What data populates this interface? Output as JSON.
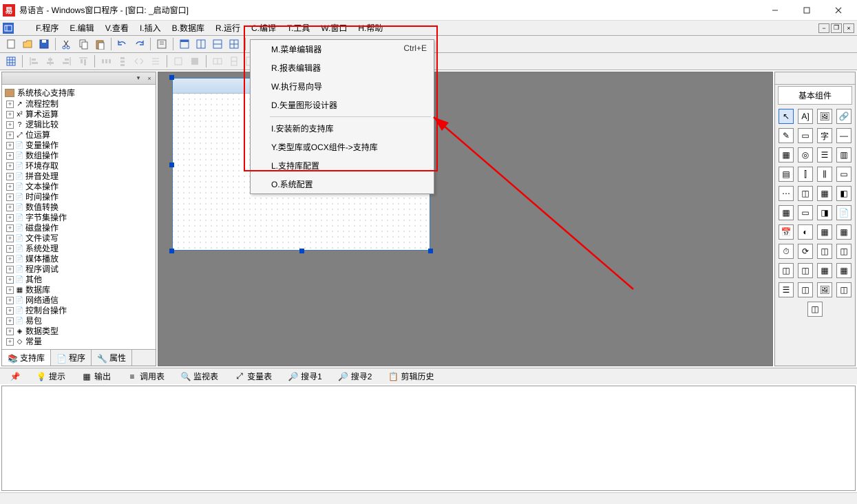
{
  "title": "易语言 - Windows窗口程序 - [窗口: _启动窗口]",
  "menus": {
    "program": "F.程序",
    "edit": "E.编辑",
    "view": "V.查看",
    "insert": "I.插入",
    "database": "B.数据库",
    "run": "R.运行",
    "compile": "C.编译",
    "tools": "T.工具",
    "window": "W.窗口",
    "help": "H.帮助"
  },
  "dropdown": {
    "menu_editor": "M.菜单编辑器",
    "menu_editor_shortcut": "Ctrl+E",
    "report_editor": "R.报表编辑器",
    "exec_wizard": "W.执行易向导",
    "vector_designer": "D.矢量图形设计器",
    "install_lib": "I.安装新的支持库",
    "ocx_lib": "Y.类型库或OCX组件->支持库",
    "lib_config": "L.支持库配置",
    "sys_config": "O.系统配置"
  },
  "tree": {
    "root": "系统核心支持库",
    "items": [
      {
        "icon": "↗",
        "label": "流程控制"
      },
      {
        "icon": "x²",
        "label": "算术运算"
      },
      {
        "icon": "?",
        "label": "逻辑比较"
      },
      {
        "icon": "⤢",
        "label": "位运算"
      },
      {
        "icon": "📄",
        "label": "变量操作"
      },
      {
        "icon": "📄",
        "label": "数组操作"
      },
      {
        "icon": "📄",
        "label": "环境存取"
      },
      {
        "icon": "📄",
        "label": "拼音处理"
      },
      {
        "icon": "📄",
        "label": "文本操作"
      },
      {
        "icon": "📄",
        "label": "时间操作"
      },
      {
        "icon": "📄",
        "label": "数值转换"
      },
      {
        "icon": "📄",
        "label": "字节集操作"
      },
      {
        "icon": "📄",
        "label": "磁盘操作"
      },
      {
        "icon": "📄",
        "label": "文件读写"
      },
      {
        "icon": "📄",
        "label": "系统处理"
      },
      {
        "icon": "📄",
        "label": "媒体播放"
      },
      {
        "icon": "📄",
        "label": "程序调试"
      },
      {
        "icon": "📄",
        "label": "其他"
      },
      {
        "icon": "▦",
        "label": "数据库"
      },
      {
        "icon": "📄",
        "label": "网络通信"
      },
      {
        "icon": "📄",
        "label": "控制台操作"
      },
      {
        "icon": "📄",
        "label": "易包"
      },
      {
        "icon": "◈",
        "label": "数据类型"
      },
      {
        "icon": "◇",
        "label": "常量"
      }
    ]
  },
  "left_tabs": {
    "lib": "支持库",
    "prog": "程序",
    "attr": "属性"
  },
  "right_panel": {
    "title": "基本组件"
  },
  "bottom_tabs": {
    "hint": "提示",
    "output": "输出",
    "calltable": "调用表",
    "watch": "监视表",
    "vars": "变量表",
    "find1": "搜寻1",
    "find2": "搜寻2",
    "cliphist": "剪辑历史"
  }
}
